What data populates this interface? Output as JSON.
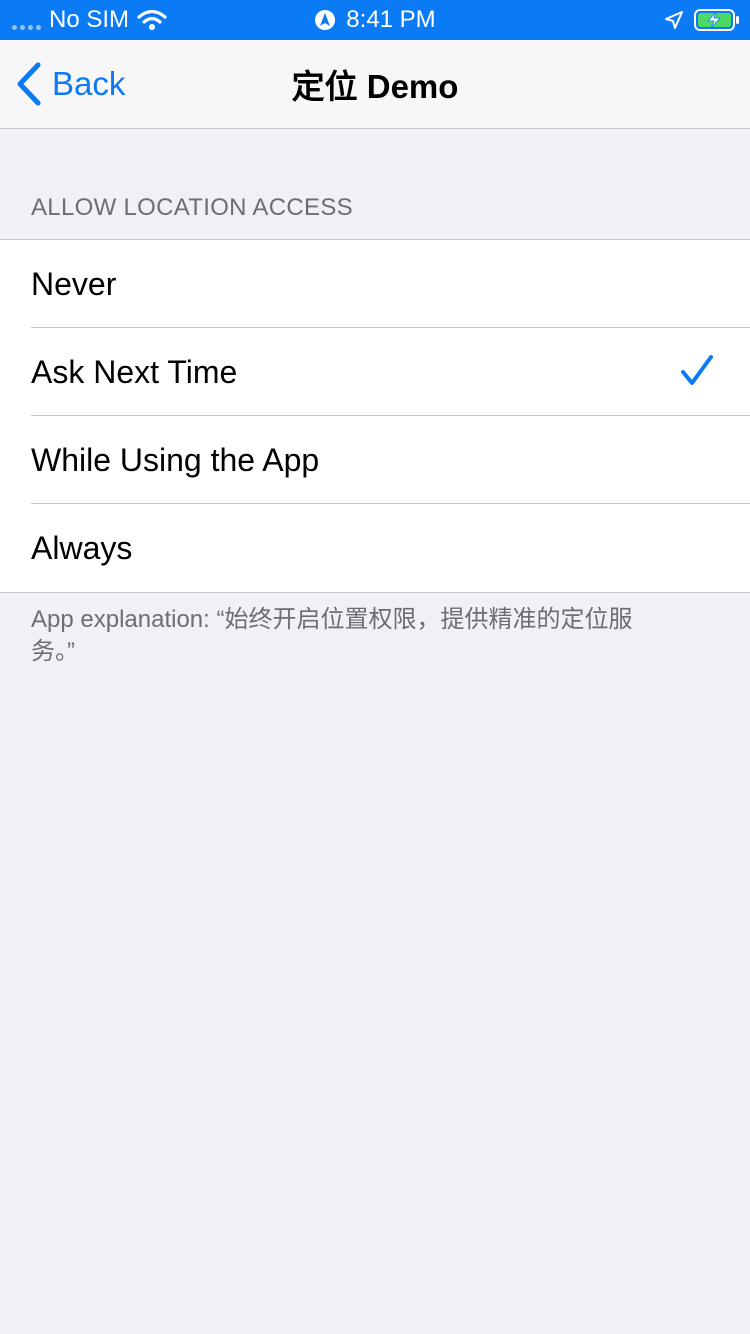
{
  "status_bar": {
    "carrier": "No SIM",
    "time": "8:41 PM",
    "icons": [
      "signal-dots-icon",
      "wifi-icon",
      "navigation-icon",
      "location-arrow-icon",
      "battery-charging-icon"
    ]
  },
  "nav": {
    "back_label": "Back",
    "title": "定位 Demo"
  },
  "section": {
    "header": "ALLOW LOCATION ACCESS",
    "options": [
      {
        "label": "Never",
        "selected": false
      },
      {
        "label": "Ask Next Time",
        "selected": true
      },
      {
        "label": "While Using the App",
        "selected": false
      },
      {
        "label": "Always",
        "selected": false
      }
    ],
    "footer": "App explanation: “始终开启位置权限，提供精准的定位服务。”"
  },
  "colors": {
    "accent": "#0a7bf5",
    "background": "#f0f0f5",
    "secondary_text": "#6d6d72",
    "battery_green": "#4cd964"
  }
}
